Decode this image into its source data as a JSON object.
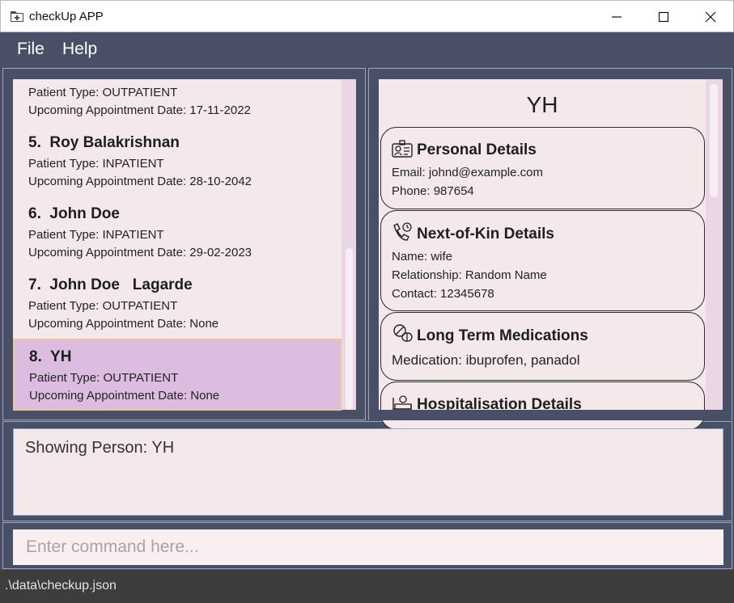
{
  "window": {
    "title": "checkUp APP",
    "icon": "folder-plus-icon"
  },
  "menu": {
    "file": "File",
    "help": "Help"
  },
  "patient_list": {
    "partial_top": {
      "type_line": "Patient Type: OUTPATIENT",
      "appt_line": "Upcoming Appointment Date: 17-11-2022"
    },
    "items": [
      {
        "name": "5.  Roy Balakrishnan",
        "type_line": "Patient Type: INPATIENT",
        "appt_line": "Upcoming Appointment Date: 28-10-2042"
      },
      {
        "name": "6.  John Doe",
        "type_line": "Patient Type: INPATIENT",
        "appt_line": "Upcoming Appointment Date: 29-02-2023"
      },
      {
        "name": "7.  John Doe   Lagarde",
        "type_line": "Patient Type: OUTPATIENT",
        "appt_line": "Upcoming Appointment Date: None"
      },
      {
        "name": "8.  YH",
        "type_line": "Patient Type: OUTPATIENT",
        "appt_line": "Upcoming Appointment Date: None"
      }
    ]
  },
  "details": {
    "name": "YH",
    "personal": {
      "title": "Personal Details",
      "icon": "id-badge-icon",
      "email": "Email: johnd@example.com",
      "phone": "Phone: 987654"
    },
    "next_of_kin": {
      "title": "Next-of-Kin Details",
      "icon": "phone-call-icon",
      "name": "Name: wife",
      "relationship": "Relationship: Random Name",
      "contact": "Contact: 12345678"
    },
    "medications": {
      "title": "Long Term Medications",
      "icon": "pills-icon",
      "medication": "Medication: ibuprofen, panadol"
    },
    "hospitalisation": {
      "title": "Hospitalisation Details",
      "icon": "hospital-bed-icon"
    }
  },
  "result": {
    "text": "Showing Person: YH"
  },
  "command": {
    "placeholder": "Enter command here..."
  },
  "status": {
    "path": ".\\data\\checkup.json"
  },
  "colors": {
    "background": "#4a4f68",
    "panel": "#f5e8ea",
    "selected": "#dcbde0",
    "selected_border": "#e8c89a",
    "status_bar": "#3d3d3d"
  }
}
